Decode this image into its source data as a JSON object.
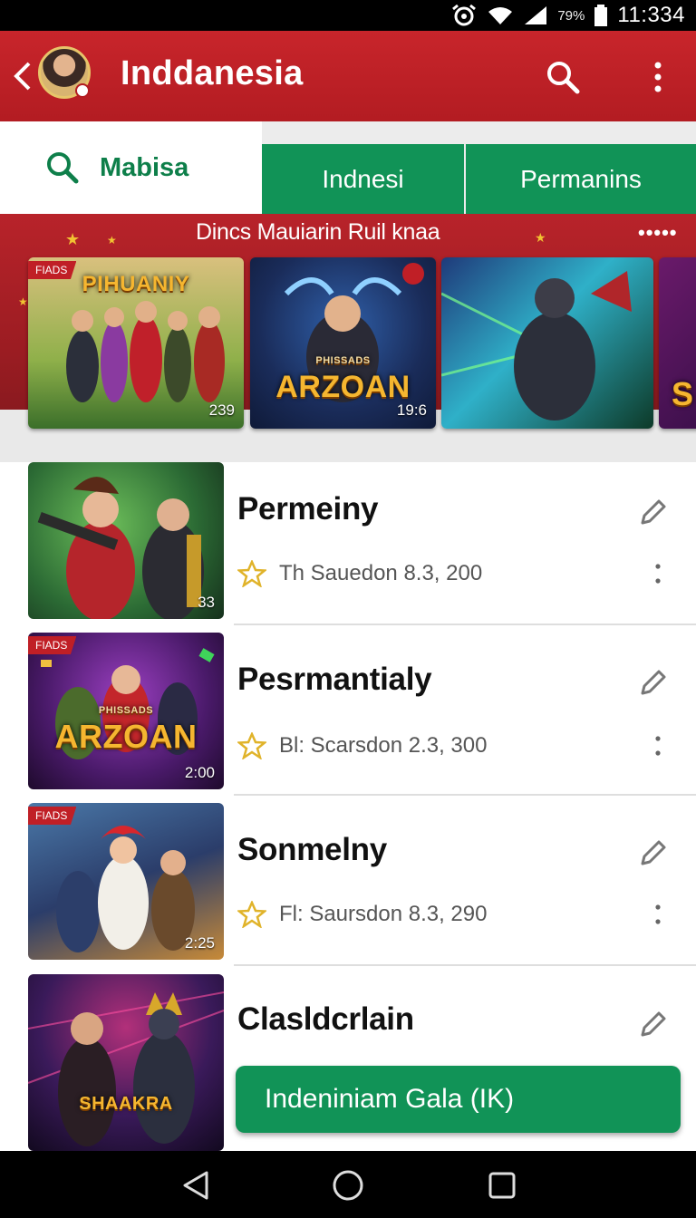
{
  "status_bar": {
    "battery_percent": "79%",
    "time": "11:334"
  },
  "app_bar": {
    "title": "Inddanesia"
  },
  "tabs": [
    {
      "label": "Mabisa",
      "active": true
    },
    {
      "label": "Indnesi",
      "active": false
    },
    {
      "label": "Permanins",
      "active": false
    }
  ],
  "banner": {
    "title": "Dincs Mauiarin Ruil knaa",
    "dots": "•••••",
    "cards": [
      {
        "badge": "FIADS",
        "logo": "PIHUANIY",
        "count": "239"
      },
      {
        "badge": "",
        "logo": "ARZOAN",
        "subtitle": "PHISSADS",
        "count": "19:6"
      },
      {
        "badge": "",
        "logo": "",
        "count": ""
      },
      {
        "badge": "",
        "logo": "S",
        "count": ""
      }
    ]
  },
  "list": [
    {
      "title": "Permeiny",
      "meta": "Th Sauedon 8.3, 200",
      "badge": "",
      "duration": "33"
    },
    {
      "title": "Pesrmantialy",
      "meta": "Bl: Scarsdon 2.3, 300",
      "badge": "FIADS",
      "duration": "2:00",
      "logo": "ARZOAN",
      "logo_sub": "PHISSADS"
    },
    {
      "title": "Sonmelny",
      "meta": "Fl: Saursdon 8.3, 290",
      "badge": "FIADS",
      "duration": "2:25"
    },
    {
      "title": "Clasldcrlain",
      "meta": "",
      "badge": "",
      "duration": "",
      "logo": "SHAAKRA"
    }
  ],
  "cta": {
    "label": "Indeniniam Gala (IK)"
  },
  "colors": {
    "brand_red": "#c8252b",
    "brand_green": "#119357",
    "text_green": "#0e7f4a"
  }
}
